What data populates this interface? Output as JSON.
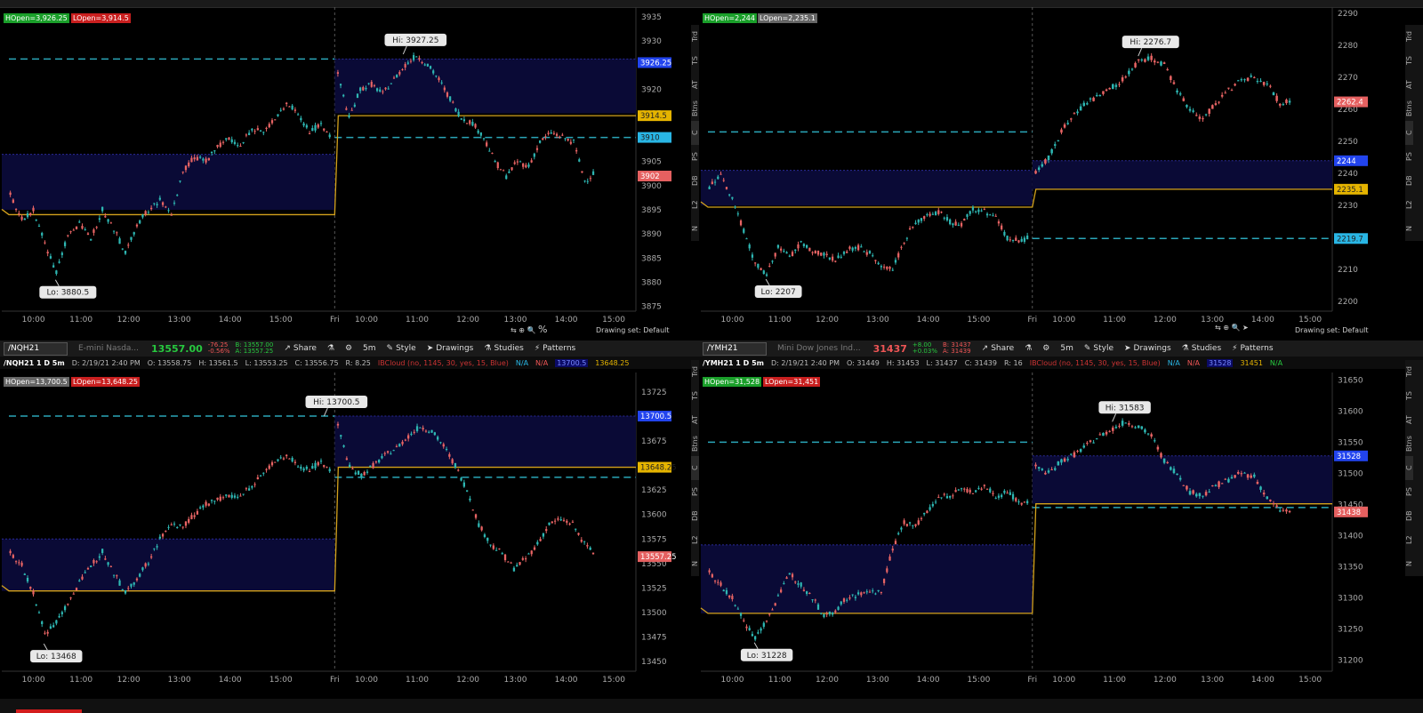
{
  "sidebar_tabs": [
    "Trd",
    "TS",
    "AT",
    "Btns",
    "C",
    "PS",
    "DB",
    "L2",
    "N"
  ],
  "drawing_set_label": "Drawing set: Default",
  "percent_label": "%",
  "panels": [
    {
      "name": "es",
      "x_labels": [
        "10:00",
        "11:00",
        "12:00",
        "13:00",
        "14:00",
        "15:00",
        "Fri",
        "10:00",
        "11:00",
        "12:00",
        "13:00",
        "14:00",
        "15:00"
      ],
      "y_ticks": [
        3935,
        3930,
        3925,
        3920,
        3915,
        3910,
        3905,
        3900,
        3895,
        3890,
        3885,
        3880,
        3875
      ],
      "y_range": [
        3874,
        3937
      ],
      "hopen_label": "HOpen=3,926.25",
      "lopen_label": "LOpen=3,914.5",
      "hi_label": "Hi: 3927.25",
      "lo_label": "Lo: 3880.5",
      "hi_value": 3927.25,
      "lo_value": 3880.5,
      "price_badges": [
        {
          "text": "3926.25",
          "value": 3925.5,
          "color": "#2244ee"
        },
        {
          "text": "3914.5",
          "value": 3914.5,
          "color": "#e5b400"
        },
        {
          "text": "3910",
          "value": 3910,
          "color": "#29b6e5"
        },
        {
          "text": "3902",
          "value": 3902,
          "color": "#e56060"
        }
      ],
      "dashed_levels": [
        3926.25,
        3910
      ],
      "prev_band": [
        3895,
        3906.5
      ],
      "today_band": [
        3915,
        3926.25
      ],
      "gold_prev": 3894,
      "gold_today": 3914.5,
      "path_prev": [
        3898,
        3893,
        3895,
        3888,
        3882,
        3890,
        3892,
        3889,
        3895,
        3891,
        3886,
        3892,
        3895,
        3897,
        3894,
        3903,
        3906,
        3905,
        3908,
        3910,
        3908,
        3912,
        3911,
        3914,
        3917,
        3915,
        3911,
        3913,
        3909
      ],
      "path_today": [
        3923,
        3914,
        3920,
        3921,
        3919,
        3922,
        3925,
        3927,
        3925,
        3922,
        3918,
        3914,
        3913,
        3910,
        3905,
        3902,
        3905,
        3904,
        3909,
        3911,
        3910,
        3909,
        3901,
        3903
      ]
    },
    {
      "name": "rty",
      "x_labels": [
        "10:00",
        "11:00",
        "12:00",
        "13:00",
        "14:00",
        "15:00",
        "Fri",
        "10:00",
        "11:00",
        "12:00",
        "13:00",
        "14:00",
        "15:00"
      ],
      "y_ticks": [
        2290,
        2280,
        2270,
        2260,
        2250,
        2240,
        2230,
        2220,
        2210,
        2200
      ],
      "y_range": [
        2197,
        2292
      ],
      "hopen_label": "HOpen=2,244",
      "lopen_label": "LOpen=2,235.1",
      "hi_label": "Hi: 2276.7",
      "lo_label": "Lo: 2207",
      "hi_value": 2276.7,
      "lo_value": 2207,
      "price_badges": [
        {
          "text": "2262.4",
          "value": 2262.4,
          "color": "#e56060"
        },
        {
          "text": "2244",
          "value": 2244,
          "color": "#2244ee"
        },
        {
          "text": "2235.1",
          "value": 2235.1,
          "color": "#e5b400"
        },
        {
          "text": "2219.7",
          "value": 2219.7,
          "color": "#29b6e5"
        }
      ],
      "dashed_levels": [
        2253,
        2219.7
      ],
      "prev_band": [
        2230,
        2241
      ],
      "today_band": [
        2235.1,
        2244
      ],
      "gold_prev": 2229.5,
      "gold_today": 2235.1,
      "path_prev": [
        2236,
        2240,
        2232,
        2222,
        2212,
        2208,
        2217,
        2214,
        2218,
        2216,
        2215,
        2213,
        2216,
        2217,
        2215,
        2211,
        2210,
        2219,
        2225,
        2227,
        2228,
        2225,
        2224,
        2229,
        2228,
        2226,
        2220,
        2219,
        2220
      ],
      "path_today": [
        2240,
        2245,
        2253,
        2259,
        2262,
        2265,
        2267,
        2270,
        2275,
        2276,
        2274,
        2266,
        2260,
        2257,
        2262,
        2266,
        2269,
        2270,
        2268,
        2262,
        2263
      ]
    },
    {
      "name": "nq",
      "symbol": "/NQH21",
      "desc": "E-mini Nasda...",
      "last": "13557.00",
      "chg1": "-76.25",
      "chg2": "-0.56%",
      "bid": "B: 13557.00",
      "ask": "A: 13557.25",
      "toolbar_items": [
        "Share",
        "5m",
        "Style",
        "Drawings",
        "Studies",
        "Patterns"
      ],
      "info_items": [
        "/NQH21 1 D 5m",
        "D: 2/19/21 2:40 PM",
        "O: 13558.75",
        "H: 13561.5",
        "L: 13553.25",
        "C: 13556.75",
        "R: 8.25"
      ],
      "study_text": "IBCloud (no, 1145, 30, yes, 15, Blue)",
      "na1": "N/A",
      "na2": "N/A",
      "study_value1": "13700.5",
      "study_value2": "13648.25",
      "x_labels": [
        "10:00",
        "11:00",
        "12:00",
        "13:00",
        "14:00",
        "15:00",
        "Fri",
        "10:00",
        "11:00",
        "12:00",
        "13:00",
        "14:00",
        "15:00"
      ],
      "y_ticks": [
        13725,
        13700,
        13675,
        13650,
        13625,
        13600,
        13575,
        13550,
        13525,
        13500,
        13475,
        13450
      ],
      "y_range": [
        13440,
        13745
      ],
      "hopen_label": "HOpen=13,700.5",
      "lopen_label": "LOpen=13,648.25",
      "hi_label": "Hi: 13700.5",
      "lo_label": "Lo: 13468",
      "hi_value": 13700.5,
      "lo_value": 13468,
      "price_badges": [
        {
          "text": "13700.5",
          "value": 13700.5,
          "color": "#2244ee"
        },
        {
          "text": "13648.25",
          "value": 13648.25,
          "color": "#e5b400"
        },
        {
          "text": "13557.25",
          "value": 13557,
          "color": "#e56060"
        }
      ],
      "dashed_levels": [
        13700.5,
        13638
      ],
      "prev_band": [
        13522,
        13575
      ],
      "today_band": [
        13648.25,
        13700.5
      ],
      "gold_prev": 13522,
      "gold_today": 13648.25,
      "path_prev": [
        13560,
        13548,
        13520,
        13478,
        13490,
        13510,
        13530,
        13548,
        13562,
        13540,
        13520,
        13535,
        13552,
        13575,
        13590,
        13588,
        13600,
        13610,
        13615,
        13620,
        13618,
        13630,
        13642,
        13655,
        13660,
        13650,
        13645,
        13655,
        13640
      ],
      "path_today": [
        13690,
        13648,
        13640,
        13650,
        13660,
        13668,
        13680,
        13690,
        13685,
        13670,
        13650,
        13625,
        13590,
        13570,
        13560,
        13545,
        13555,
        13570,
        13590,
        13595,
        13590,
        13570,
        13558
      ]
    },
    {
      "name": "ym",
      "symbol": "/YMH21",
      "desc": "Mini Dow Jones Ind...",
      "last": "31437",
      "chg1": "+8.00",
      "chg2": "+0.03%",
      "bid": "B: 31437",
      "ask": "A: 31439",
      "toolbar_items": [
        "Share",
        "5m",
        "Style",
        "Drawings",
        "Studies",
        "Patterns"
      ],
      "info_items": [
        "/YMH21 1 D 5m",
        "D: 2/19/21 2:40 PM",
        "O: 31449",
        "H: 31453",
        "L: 31437",
        "C: 31439",
        "R: 16"
      ],
      "study_text": "IBCloud (no, 1145, 30, yes, 15, Blue)",
      "na1": "N/A",
      "na2": "N/A",
      "study_value1": "31528",
      "study_value2": "31451",
      "na3": "N/A",
      "x_labels": [
        "10:00",
        "11:00",
        "12:00",
        "13:00",
        "14:00",
        "15:00",
        "Fri",
        "10:00",
        "11:00",
        "12:00",
        "13:00",
        "14:00",
        "15:00"
      ],
      "y_ticks": [
        31650,
        31600,
        31550,
        31500,
        31450,
        31400,
        31350,
        31300,
        31250,
        31200
      ],
      "y_range": [
        31182,
        31662
      ],
      "hopen_label": "HOpen=31,528",
      "lopen_label": "LOpen=31,451",
      "hi_label": "Hi: 31583",
      "lo_label": "Lo: 31228",
      "hi_value": 31583,
      "lo_value": 31228,
      "price_badges": [
        {
          "text": "31528",
          "value": 31528,
          "color": "#2244ee"
        },
        {
          "text": "31438",
          "value": 31438,
          "color": "#e56060"
        }
      ],
      "dashed_levels": [
        31550,
        31445
      ],
      "prev_band": [
        31275,
        31385
      ],
      "today_band": [
        31451,
        31528
      ],
      "gold_prev": 31275,
      "gold_today": 31451,
      "path_prev": [
        31340,
        31320,
        31300,
        31262,
        31235,
        31265,
        31300,
        31340,
        31320,
        31300,
        31270,
        31280,
        31300,
        31305,
        31310,
        31310,
        31380,
        31420,
        31415,
        31440,
        31460,
        31465,
        31475,
        31470,
        31480,
        31462,
        31470,
        31455,
        31450
      ],
      "path_today": [
        31510,
        31500,
        31520,
        31530,
        31545,
        31560,
        31572,
        31583,
        31575,
        31560,
        31520,
        31500,
        31470,
        31465,
        31480,
        31490,
        31500,
        31495,
        31460,
        31440,
        31440
      ]
    }
  ]
}
